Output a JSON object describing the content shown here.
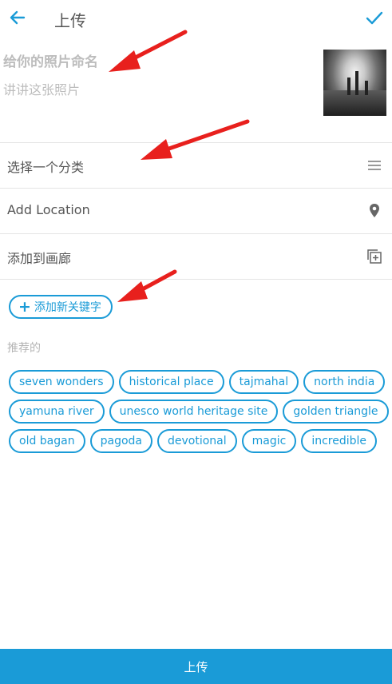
{
  "header": {
    "title": "上传",
    "back_icon": "arrow-left-icon",
    "confirm_icon": "check-icon"
  },
  "photo": {
    "title_placeholder": "给你的照片命名",
    "description_placeholder": "讲讲这张照片"
  },
  "options": {
    "category_label": "选择一个分类",
    "category_icon": "menu-lines-icon",
    "location_label": "Add Location",
    "location_icon": "map-pin-icon",
    "gallery_label": "添加到画廊",
    "gallery_icon": "add-to-gallery-icon"
  },
  "keywords": {
    "add_label": "添加新关键字",
    "recommended_label": "推荐的",
    "tags_row1": [
      "seven wonders",
      "historical place",
      "tajmahal",
      "north india"
    ],
    "tags_row2": [
      "yamuna river",
      "unesco world heritage site",
      "golden triangle"
    ],
    "tags_row3": [
      "old bagan",
      "pagoda",
      "devotional",
      "magic",
      "incredible"
    ]
  },
  "footer": {
    "upload_label": "上传"
  },
  "colors": {
    "accent": "#1a9bd7",
    "annotation_arrow": "#e8201d"
  }
}
